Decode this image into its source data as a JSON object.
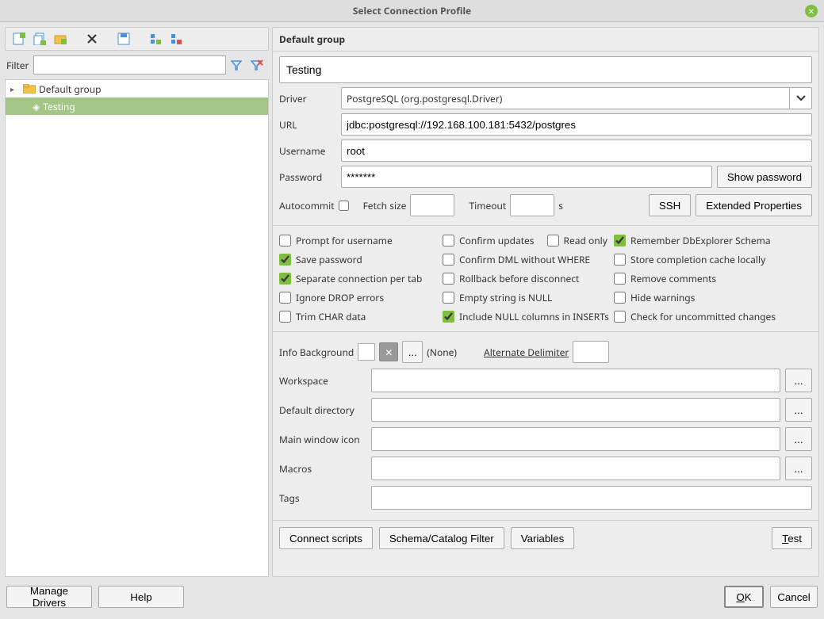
{
  "title": "Select Connection Profile",
  "left": {
    "filter_label": "Filter",
    "group": "Default group",
    "item": "Testing"
  },
  "form": {
    "group_header": "Default group",
    "name": "Testing",
    "driver_label": "Driver",
    "driver": "PostgreSQL (org.postgresql.Driver)",
    "url_label": "URL",
    "url": "jdbc:postgresql://192.168.100.181:5432/postgres",
    "username_label": "Username",
    "username": "root",
    "password_label": "Password",
    "password": "*******",
    "show_password": "Show password",
    "autocommit_label": "Autocommit",
    "fetch_label": "Fetch size",
    "fetch": "",
    "timeout_label": "Timeout",
    "timeout": "",
    "timeout_unit": "s",
    "ssh_btn": "SSH",
    "extprops_btn": "Extended Properties"
  },
  "checks": {
    "c1": "Prompt for username",
    "v1": false,
    "c2": "Confirm updates",
    "v2": false,
    "c3": "Read only",
    "v3": false,
    "c4": "Remember DbExplorer Schema",
    "v4": true,
    "c5": "Save password",
    "v5": true,
    "c6": "Confirm DML without WHERE",
    "v6": false,
    "c7": "Store completion cache locally",
    "v7": false,
    "c8": "Separate connection per tab",
    "v8": true,
    "c9": "Rollback before disconnect",
    "v9": false,
    "c10": "Remove comments",
    "v10": false,
    "c11": "Ignore DROP errors",
    "v11": false,
    "c12": "Empty string is NULL",
    "v12": false,
    "c13": "Hide warnings",
    "v13": false,
    "c14": "Trim CHAR data",
    "v14": false,
    "c15": "Include NULL columns in INSERTs",
    "v15": true,
    "c16": "Check for uncommitted changes",
    "v16": false
  },
  "info": {
    "label": "Info Background",
    "ellipsis": "...",
    "none": "(None)",
    "delimiter_label": "Alternate Delimiter",
    "delimiter": ""
  },
  "paths": {
    "workspace_label": "Workspace",
    "defdir_label": "Default directory",
    "icon_label": "Main window icon",
    "macros_label": "Macros",
    "tags_label": "Tags",
    "browse": "..."
  },
  "buttons": {
    "connect_scripts": "Connect scripts",
    "schema_filter": "Schema/Catalog Filter",
    "variables": "Variables",
    "test": "Test"
  },
  "footer": {
    "manage_drivers": "Manage Drivers",
    "help": "Help",
    "ok": "OK",
    "cancel": "Cancel"
  }
}
